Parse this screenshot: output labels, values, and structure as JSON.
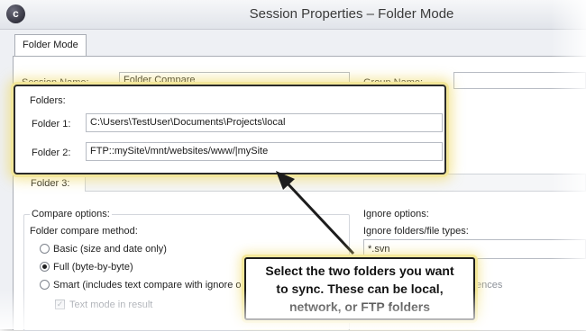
{
  "window": {
    "title": "Session Properties – Folder Mode",
    "app_icon_glyph": "c"
  },
  "tabs": [
    {
      "label": "Folder Mode"
    }
  ],
  "session": {
    "name_label": "Session Name:",
    "name_value": "Folder Compare",
    "group_label": "Group Name:",
    "group_value": ""
  },
  "folders": {
    "section_label": "Folders:",
    "items": [
      {
        "label": "Folder 1:",
        "value": "C:\\Users\\TestUser\\Documents\\Projects\\local"
      },
      {
        "label": "Folder 2:",
        "value": "FTP::mySite\\/mnt/websites/www/|mySite"
      },
      {
        "label": "Folder 3:",
        "value": ""
      }
    ]
  },
  "compare_options": {
    "section_label": "Compare options:",
    "method_label": "Folder compare method:",
    "methods": [
      {
        "label": "Basic (size and date only)",
        "selected": false
      },
      {
        "label": "Full (byte-by-byte)",
        "selected": true
      },
      {
        "label": "Smart (includes text compare with ignore opt",
        "selected": false
      }
    ],
    "text_mode_label": "Text mode in result",
    "text_mode_checked": true
  },
  "ignore_options": {
    "section_label": "Ignore options:",
    "types_label": "Ignore folders/file types:",
    "types_value": "*.svn",
    "partial_text": "ences"
  },
  "callout": {
    "lines": [
      "Select the two folders you want",
      "to sync. These can be local,",
      "network, or FTP folders"
    ]
  },
  "colors": {
    "highlight_glow": "#f3e79a",
    "panel_bg": "#ffffff",
    "window_bg": "#eef0f4"
  }
}
